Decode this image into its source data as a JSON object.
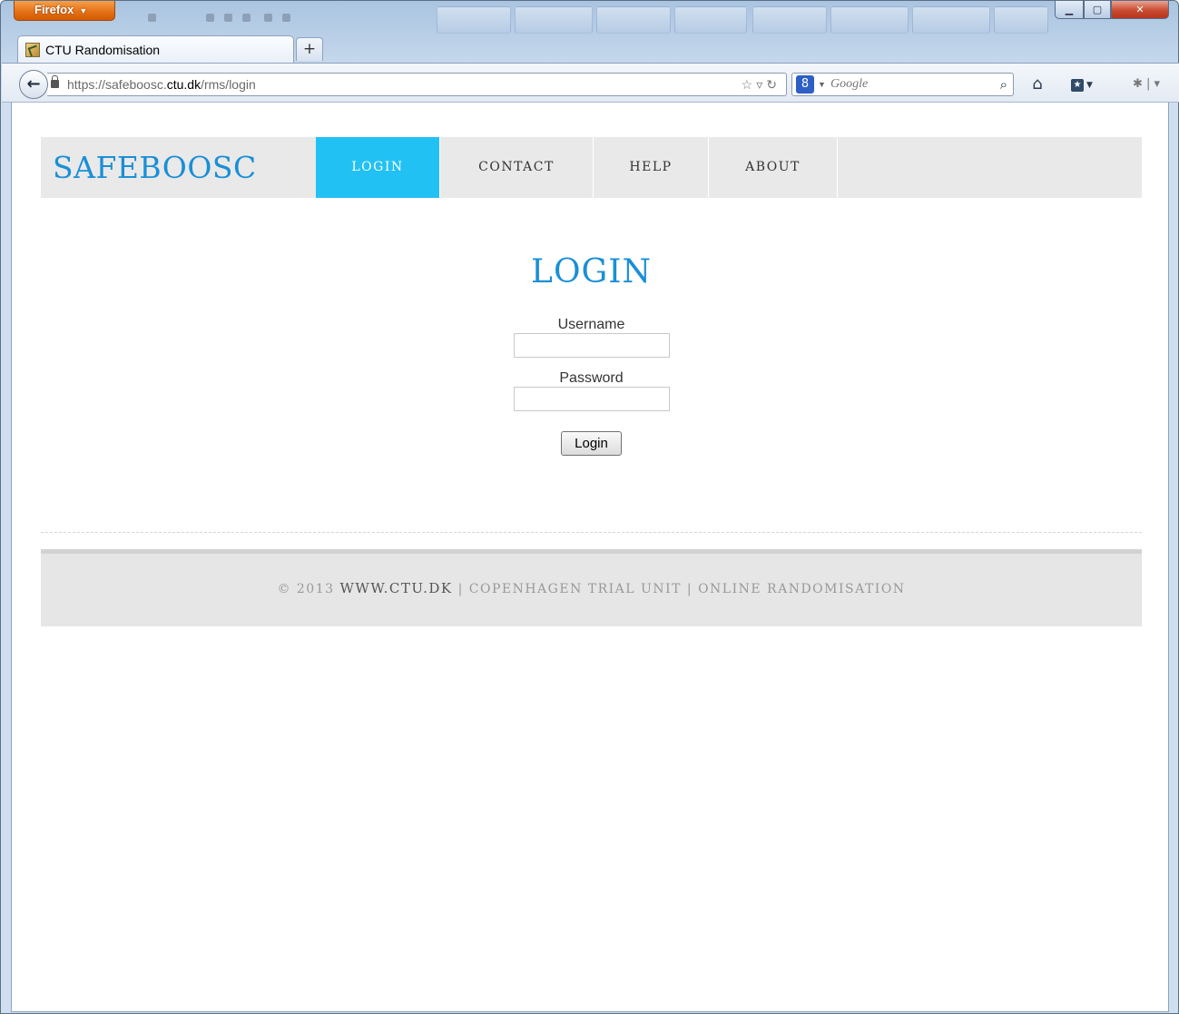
{
  "browser": {
    "menu_label": "Firefox",
    "tab_title": "CTU Randomisation",
    "new_tab_label": "+",
    "url_prefix": "https://safeboosc.",
    "url_domain": "ctu.dk",
    "url_path": "/rms/login",
    "search_placeholder": "Google",
    "icons": [
      "back-arrow-icon",
      "lock-icon",
      "star-icon",
      "reload-icon",
      "google-icon",
      "search-icon",
      "home-icon",
      "bookmarks-icon",
      "addon-icon"
    ]
  },
  "site": {
    "logo": "SAFEBOOSC",
    "nav": [
      {
        "label": "LOGIN",
        "active": true
      },
      {
        "label": "CONTACT",
        "active": false
      },
      {
        "label": "HELP",
        "active": false
      },
      {
        "label": "ABOUT",
        "active": false
      }
    ],
    "accent_color": "#22c1f4",
    "brand_color": "#1a8fd6"
  },
  "login": {
    "title": "LOGIN",
    "username_label": "Username",
    "username_value": "",
    "password_label": "Password",
    "password_value": "",
    "submit_label": "Login"
  },
  "footer": {
    "copyright": "© 2013",
    "site": "WWW.CTU.DK",
    "separator": "|",
    "unit": "COPENHAGEN TRIAL UNIT",
    "service": "ONLINE RANDOMISATION"
  }
}
